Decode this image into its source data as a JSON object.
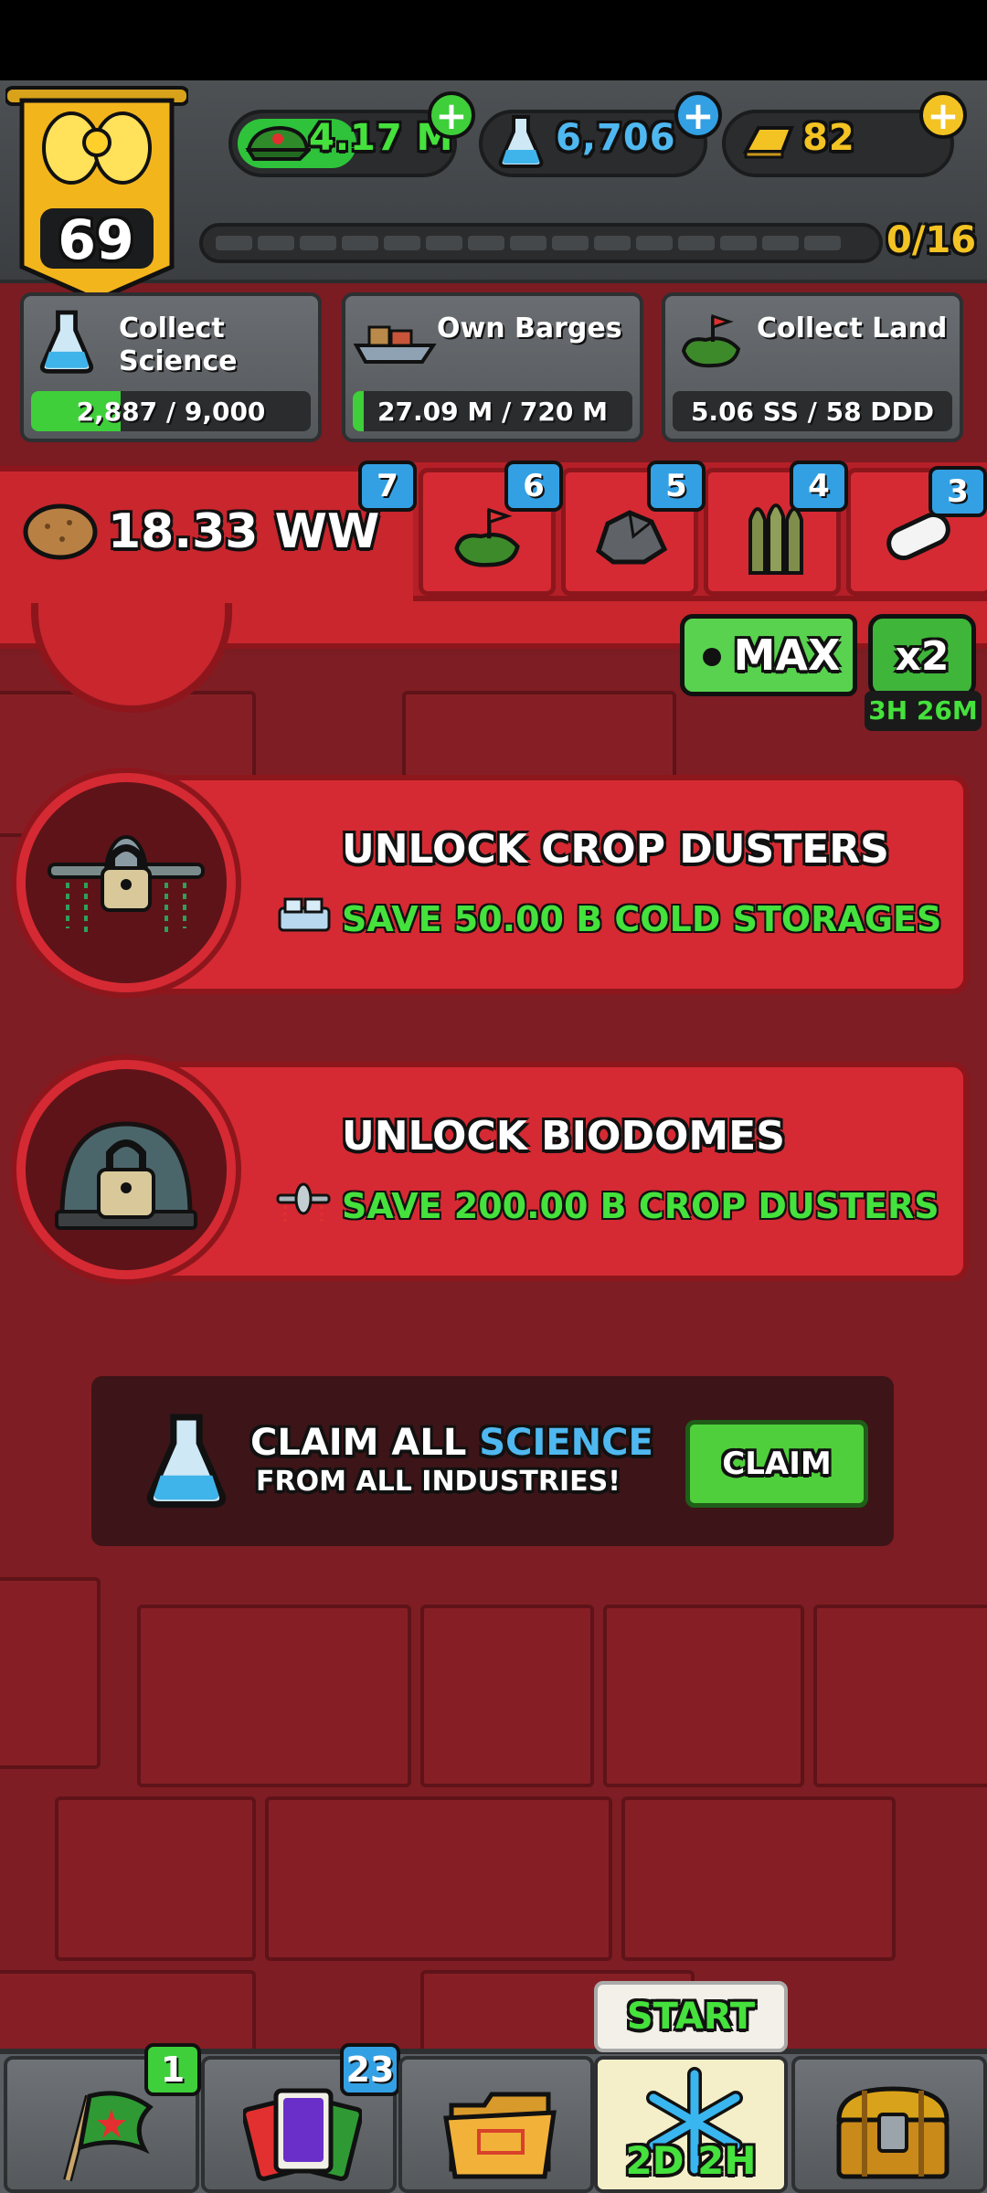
{
  "player": {
    "level": "69"
  },
  "resources": {
    "cash": "4.17 M",
    "science": "6,706",
    "gold": "82"
  },
  "xp": {
    "progress": "0/16"
  },
  "missions": [
    {
      "title_line1": "Collect",
      "title_line2": "Science",
      "progress": "2,887 / 9,000",
      "fill_fraction": 0.32
    },
    {
      "title_line1": "Own Barges",
      "title_line2": "",
      "progress": "27.09 M / 720 M",
      "fill_fraction": 0.04
    },
    {
      "title_line1": "Collect Land",
      "title_line2": "",
      "progress": "5.06 SS / 58 DDD",
      "fill_fraction": 0.0
    }
  ],
  "product": {
    "value": "18.33 WW",
    "tabs": [
      {
        "badge": "7",
        "icon": "land-icon"
      },
      {
        "badge": "6",
        "icon": "land-flag-icon"
      },
      {
        "badge": "5",
        "icon": "rocks-icon"
      },
      {
        "badge": "4",
        "icon": "bullets-icon"
      },
      {
        "badge": "3",
        "icon": "pill-icon"
      }
    ],
    "max_label": "MAX",
    "boost_label": "x2",
    "boost_timer": "3H 26M"
  },
  "unlocks": [
    {
      "title": "UNLOCK CROP DUSTERS",
      "requirement": "SAVE 50.00 B COLD STORAGES",
      "icon": "crop-duster-lock-icon"
    },
    {
      "title": "UNLOCK BIODOMES",
      "requirement": "SAVE 200.00 B CROP DUSTERS",
      "icon": "biodome-lock-icon"
    }
  ],
  "claim": {
    "title_prefix": "CLAIM ALL ",
    "title_highlight": "SCIENCE",
    "subtitle": "FROM ALL INDUSTRIES!",
    "button": "CLAIM"
  },
  "bottom_nav": {
    "missions_badge": "1",
    "cards_badge": "23",
    "freeze_tip": "START",
    "freeze_timer": "2D 2H"
  },
  "colors": {
    "accent_green": "#45e13c",
    "panel_red": "#d52a33",
    "banner_gold": "#f3b51c",
    "badge_blue": "#33a0e4"
  }
}
